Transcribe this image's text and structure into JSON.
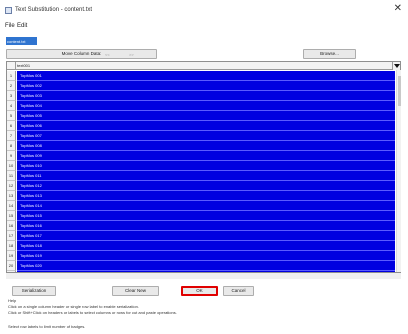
{
  "window": {
    "title": "Text Substitution - content.txt",
    "close_glyph": "✕"
  },
  "menu": {
    "items": [
      "File",
      "Edit"
    ]
  },
  "name_field": {
    "value": "content.txt"
  },
  "toolbar": {
    "move_label": "Move Column Data:",
    "spin_left": "<<",
    "spin_right": ">>",
    "browse_label": "Browse..."
  },
  "grid": {
    "column_header": "text001",
    "rows": [
      {
        "num": "1",
        "value": "TopMos 001"
      },
      {
        "num": "2",
        "value": "TopMos 002"
      },
      {
        "num": "3",
        "value": "TopMos 003"
      },
      {
        "num": "4",
        "value": "TopMos 004"
      },
      {
        "num": "5",
        "value": "TopMos 005"
      },
      {
        "num": "6",
        "value": "TopMos 006"
      },
      {
        "num": "7",
        "value": "TopMos 007"
      },
      {
        "num": "8",
        "value": "TopMos 008"
      },
      {
        "num": "9",
        "value": "TopMos 009"
      },
      {
        "num": "10",
        "value": "TopMos 010"
      },
      {
        "num": "11",
        "value": "TopMos 011"
      },
      {
        "num": "12",
        "value": "TopMos 012"
      },
      {
        "num": "13",
        "value": "TopMos 013"
      },
      {
        "num": "14",
        "value": "TopMos 014"
      },
      {
        "num": "15",
        "value": "TopMos 015"
      },
      {
        "num": "16",
        "value": "TopMos 016"
      },
      {
        "num": "17",
        "value": "TopMos 017"
      },
      {
        "num": "18",
        "value": "TopMos 018"
      },
      {
        "num": "19",
        "value": "TopMos 019"
      },
      {
        "num": "20",
        "value": "TopMos 020"
      },
      {
        "num": "21",
        "value": "TopMos 021"
      }
    ]
  },
  "buttons": {
    "serialize": "Serialization",
    "clear_new": "Clear New",
    "ok": "OK",
    "cancel": "Cancel"
  },
  "help": {
    "title": "Help",
    "line1": "Click on a single column header or single row label to enable serialization.",
    "line2": "Click or Shift+Click on headers or labels to select columns or rows for cut and paste operations.",
    "status": "Select row labels to limit number of badges."
  },
  "colors": {
    "selection": "#0000e0",
    "ok_highlight": "#e00000",
    "field_highlight": "#2f74d0"
  }
}
